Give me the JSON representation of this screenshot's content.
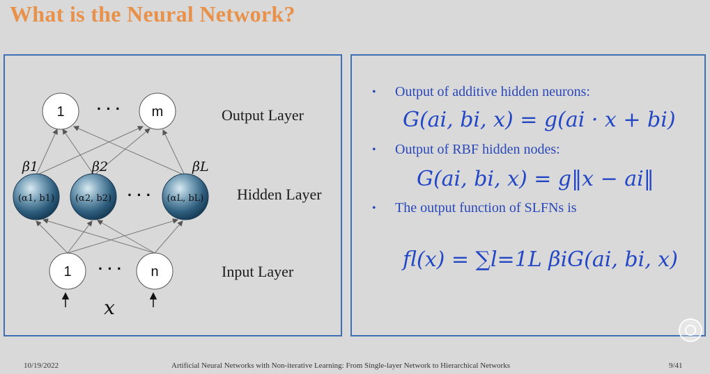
{
  "slide": {
    "title": "What is the Neural Network?"
  },
  "diagram": {
    "layers": {
      "output": "Output Layer",
      "hidden": "Hidden Layer",
      "input": "Input Layer"
    },
    "output_nodes": [
      "1",
      "m"
    ],
    "input_nodes": [
      "1",
      "n"
    ],
    "ellipsis": "· · ·",
    "input_symbol": "x",
    "betas": [
      "β1",
      "β2",
      "βL"
    ],
    "hidden_nodes": [
      "(α1, b1)",
      "(α2, b2)",
      "(αL, bL)"
    ]
  },
  "bullets": [
    {
      "text": "Output of additive hidden neurons:"
    },
    {
      "text": "Output of RBF hidden nodes:"
    },
    {
      "text": "The output function of SLFNs is"
    }
  ],
  "formulas": {
    "additive": "G(ai, bi, x) = g(ai · x + bi)",
    "rbf": "G(ai, bi, x) = g‖x − ai‖",
    "slfn": "fl(x) = ∑l=1L βiG(ai, bi, x)"
  },
  "footer": {
    "date": "10/19/2022",
    "caption": "Artificial Neural Networks with Non-iterative Learning: From Single-layer Network to Hierarchical Networks",
    "page": "9/41"
  },
  "colors": {
    "title": "#e8914a",
    "accent_blue": "#3f6fb3",
    "formula_blue": "#2347c4"
  }
}
